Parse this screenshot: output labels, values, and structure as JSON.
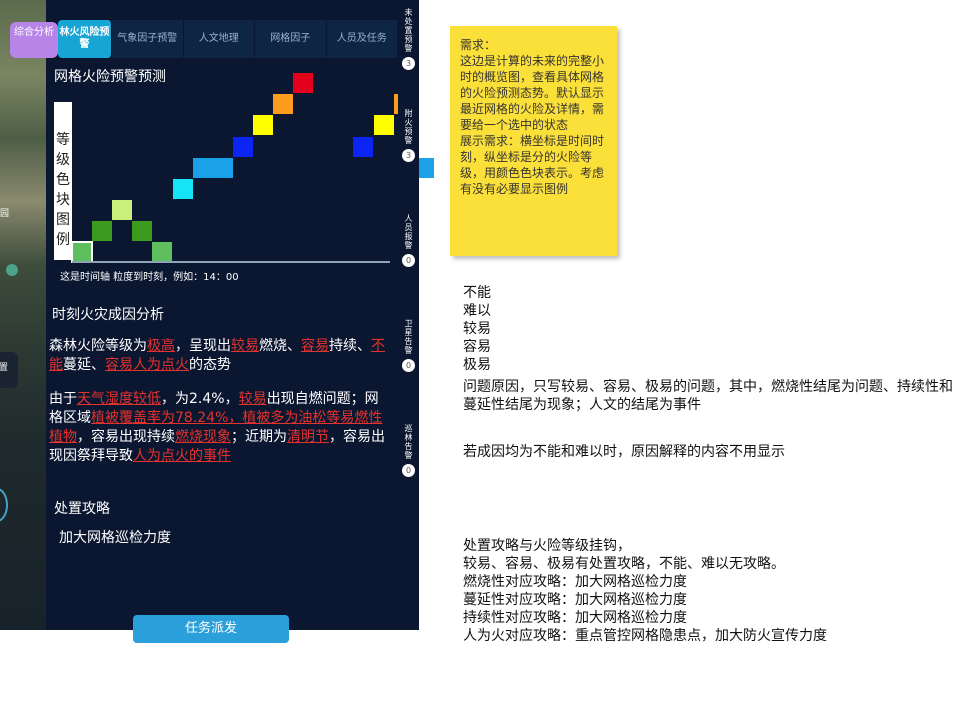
{
  "header": {
    "badge_label": "综合分析",
    "tabs": [
      {
        "label": "林火风险预警",
        "active": true
      },
      {
        "label": "气象因子预警",
        "active": false
      },
      {
        "label": "人文地理",
        "active": false
      },
      {
        "label": "网格因子",
        "active": false
      },
      {
        "label": "人员及任务",
        "active": false
      }
    ]
  },
  "forecast": {
    "title": "网格火险预警预测",
    "y_label": "等级色块图例",
    "x_caption": "这是时间轴 粒度到时刻，例如：14：00"
  },
  "chart_data": {
    "type": "heatmap",
    "title": "网格火险预警预测",
    "ylabel": "等级色块图例",
    "xlabel": "这是时间轴 粒度到时刻，例如：14：00",
    "level_colors": [
      "#5fbf5f",
      "#3c9a1e",
      "#c8f07a",
      "#16e3f5",
      "#1aa1e8",
      "#0d25f2",
      "#ffff00",
      "#ff9c1b",
      "#e3001c"
    ],
    "levels": [
      1,
      2,
      3,
      2,
      1,
      4,
      5,
      5,
      6,
      7,
      8,
      9,
      null,
      null,
      6,
      7,
      8,
      5
    ],
    "selected_index": 0
  },
  "cause": {
    "title": "时刻火灾成因分析",
    "p1": [
      "森林火险等级为",
      "极高",
      "，呈现出",
      "较易",
      "燃烧、",
      "容易",
      "持续、",
      "不能",
      "蔓延、",
      "容易人为点火",
      "的态势"
    ],
    "p2": [
      "由于",
      "天气湿度较低",
      "，为2.4%，",
      "较易",
      "出现自燃问题；网格区域",
      "植被覆盖率为78.24%，植被多为油松等易燃性植物",
      "，容易出现持续",
      "燃烧现象",
      "；近期为",
      "清明节",
      "，容易出现因祭拜导致",
      "人为点火的事件"
    ]
  },
  "strategy": {
    "title": "处置攻略",
    "text": "加大网格巡检力度"
  },
  "dispatch_label": "任务派发",
  "side_tabs": [
    {
      "label": "未处置预警",
      "count": "3",
      "color": "#e8233a"
    },
    {
      "label": "附火预警",
      "count": "3",
      "color": "#f06a1c"
    },
    {
      "label": "人员报警",
      "count": "0",
      "color": "#e8a51c"
    },
    {
      "label": "卫星告警",
      "count": "0",
      "color": "#3aa86a"
    },
    {
      "label": "巡林告警",
      "count": "0",
      "color": "#1f9ec8"
    }
  ],
  "map": {
    "label_a": "园",
    "label_b": "置"
  },
  "sticky_note": "需求：\n这边是计算的未来的完整小时的概览图，查看具体网格的火险预测态势。默认显示最近网格的火险及详情，需要给一个选中的状态\n展示需求：横坐标是时间时刻，纵坐标是分的火险等级，用颜色色块表示。考虑有没有必要显示图例",
  "notes": {
    "levels": [
      "不能",
      "难以",
      "较易",
      "容易",
      "极易"
    ],
    "reason": "问题原因，只写较易、容易、极易的问题，其中，燃烧性结尾为问题、持续性和蔓延性结尾为现象；人文的结尾为事件",
    "no_reason": "若成因均为不能和难以时，原因解释的内容不用显示",
    "strategy": [
      "处置攻略与火险等级挂钩，",
      "较易、容易、极易有处置攻略，不能、难以无攻略。",
      "燃烧性对应攻略：加大网格巡检力度",
      "蔓延性对应攻略：加大网格巡检力度",
      "持续性对应攻略：加大网格巡检力度",
      "人为火对应攻略：重点管控网格隐患点，加大防火宣传力度"
    ]
  }
}
